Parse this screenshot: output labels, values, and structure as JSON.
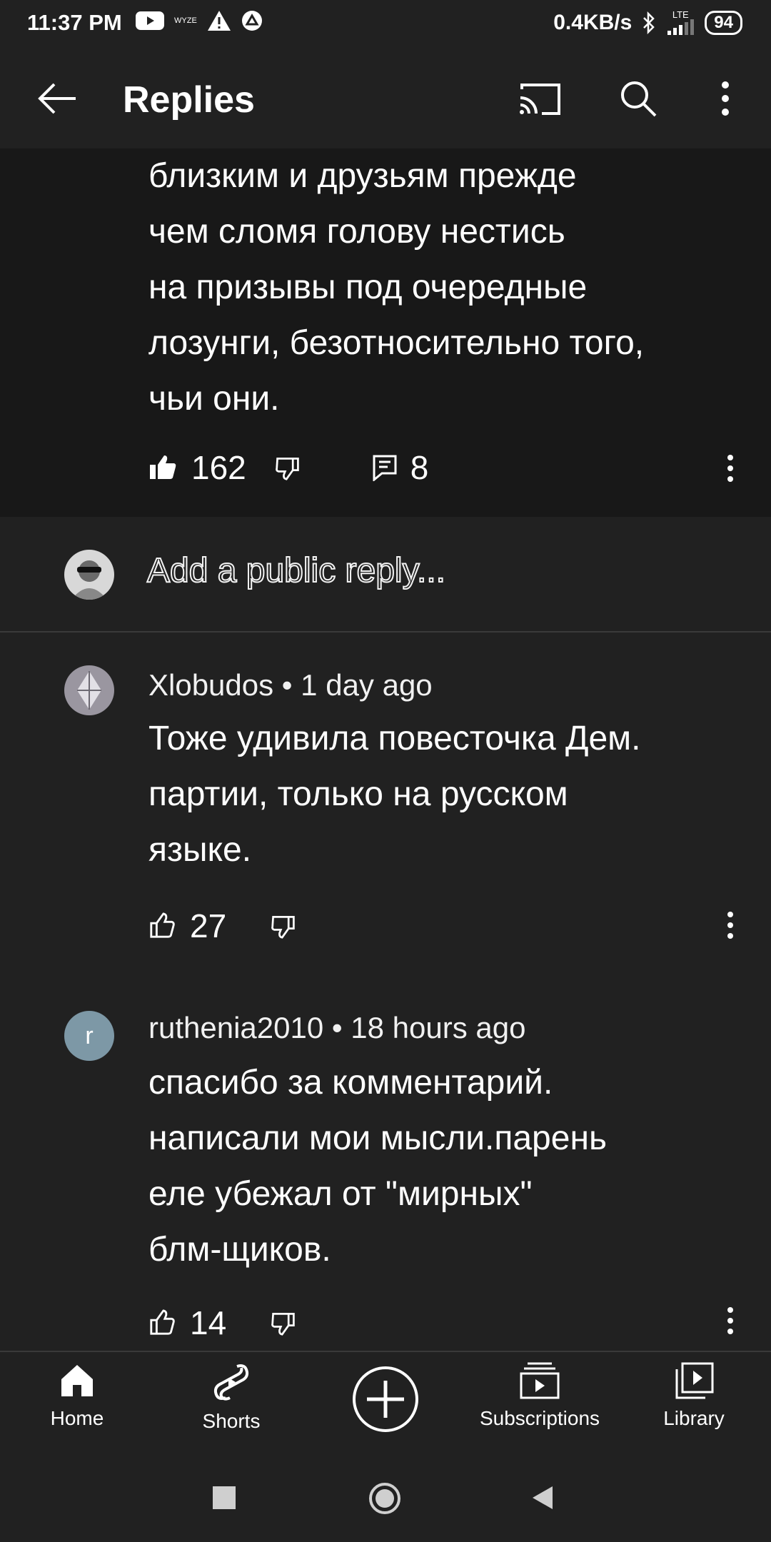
{
  "status_bar": {
    "time": "11:37 PM",
    "small_label": "WYZE",
    "net_speed": "0.4KB/s",
    "network": "LTE",
    "battery": "94"
  },
  "app_bar": {
    "title": "Replies"
  },
  "parent_comment": {
    "lines": [
      "близким и друзьям прежде",
      "чем сломя голову нестись",
      "на призывы под очередные",
      "лозунги, безотносительно того,",
      "чьи они."
    ],
    "likes": "162",
    "replies": "8"
  },
  "add_reply": {
    "placeholder": "Add a public reply..."
  },
  "replies": [
    {
      "header": "Xlobudos • 1 day ago",
      "lines": [
        "Тоже удивила повесточка Дем.",
        "партии, только на русском",
        "языке."
      ],
      "likes": "27",
      "avatar_letter": ""
    },
    {
      "header": "ruthenia2010 • 18 hours ago",
      "lines": [
        "спасибо за комментарий.",
        "написали мои мысли.парень",
        "еле убежал от \"мирных\"",
        "блм-щиков."
      ],
      "likes": "14",
      "avatar_letter": "r"
    }
  ],
  "bottom_nav": {
    "home": "Home",
    "shorts": "Shorts",
    "subscriptions": "Subscriptions",
    "library": "Library"
  },
  "colors": {
    "background": "#212121",
    "parent_background": "#181818",
    "avatar_r": "#7d98a6"
  }
}
